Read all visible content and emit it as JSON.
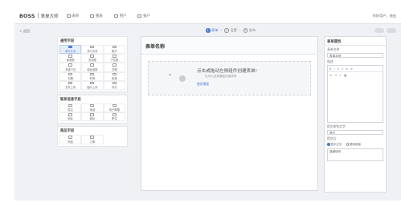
{
  "header": {
    "logo": "BOSS",
    "subtitle": "表单大师",
    "nav": [
      {
        "label": "表单",
        "icon": "form-icon"
      },
      {
        "label": "图表",
        "icon": "chart-icon"
      },
      {
        "label": "用户",
        "icon": "user-icon"
      },
      {
        "label": "账户",
        "icon": "account-icon"
      }
    ],
    "user": "你好用户，退出"
  },
  "stepbar": {
    "back": "< 返回",
    "steps": [
      {
        "num": "1",
        "label": "表单",
        "active": true
      },
      {
        "num": "2",
        "label": "设置",
        "active": false
      },
      {
        "num": "3",
        "label": "发布",
        "active": false
      }
    ]
  },
  "components": {
    "groups": [
      {
        "title": "通用字段",
        "items": [
          {
            "label": "单行文本",
            "selected": true
          },
          {
            "label": "多行文本",
            "selected": false
          },
          {
            "label": "数字",
            "selected": false
          },
          {
            "label": "单选框",
            "selected": false
          },
          {
            "label": "多选框",
            "selected": false
          },
          {
            "label": "下拉框",
            "selected": false
          },
          {
            "label": "多级下拉",
            "selected": false
          },
          {
            "label": "地址选择",
            "selected": false
          },
          {
            "label": "日期",
            "selected": false
          },
          {
            "label": "日期",
            "selected": false
          },
          {
            "label": "时间",
            "selected": false
          },
          {
            "label": "段落",
            "selected": false
          },
          {
            "label": "文件上传",
            "selected": false
          },
          {
            "label": "图片上传",
            "selected": false
          },
          {
            "label": "评分",
            "selected": false
          }
        ]
      },
      {
        "title": "联系信息字段",
        "items": [
          {
            "label": "姓名",
            "selected": false
          },
          {
            "label": "电话",
            "selected": false
          },
          {
            "label": "电子邮箱",
            "selected": false
          },
          {
            "label": "地址",
            "selected": false
          },
          {
            "label": "网址",
            "selected": false
          },
          {
            "label": "职位",
            "selected": false
          }
        ]
      },
      {
        "title": "商品字段",
        "items": [
          {
            "label": "商品",
            "selected": false
          },
          {
            "label": "订单",
            "selected": false
          }
        ]
      }
    ]
  },
  "canvas": {
    "title": "表单名称",
    "drop_title": "点击或拖动左侧组件创建表单!",
    "drop_sub": "也可以选择模板创建表单",
    "drop_link_prefix": "",
    "drop_link": "使用模板"
  },
  "props": {
    "title": "表单属性",
    "name_label": "表单名称",
    "name_value": "表单名称",
    "desc_label": "描述",
    "submit_label": "提交按钮文字",
    "submit_value": "提交",
    "after_label": "提交后",
    "radio": [
      {
        "label": "显示文字",
        "on": true
      },
      {
        "label": "跳转链接",
        "on": false
      }
    ],
    "thanks": "感谢填写"
  }
}
